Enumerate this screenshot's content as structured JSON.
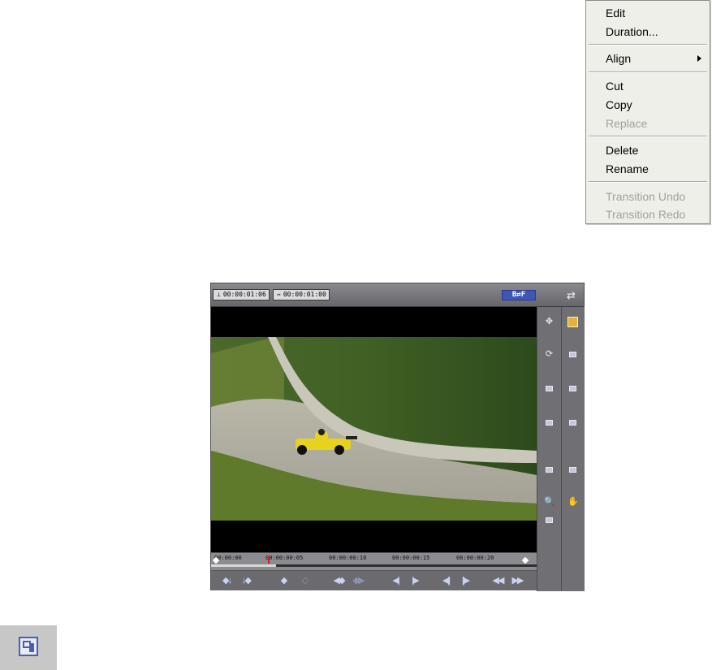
{
  "context_menu": {
    "items": [
      {
        "label": "Edit",
        "enabled": true
      },
      {
        "label": "Duration...",
        "enabled": true
      },
      {
        "label": "Align",
        "enabled": true,
        "submenu": true
      },
      {
        "label": "Cut",
        "enabled": true
      },
      {
        "label": "Copy",
        "enabled": true
      },
      {
        "label": "Replace",
        "enabled": false
      },
      {
        "label": "Delete",
        "enabled": true
      },
      {
        "label": "Rename",
        "enabled": true
      },
      {
        "label": "Transition Undo",
        "enabled": false
      },
      {
        "label": "Transition Redo",
        "enabled": false
      }
    ]
  },
  "preview": {
    "timecode_position": "00:00:01:06",
    "timecode_duration": "00:00:01:00",
    "bf_toggle": "B⇄F",
    "ruler_ticks": [
      "00:00:00",
      "00:00:00:05",
      "00:00:00:10",
      "00:00:00:15",
      "00:00:00:20"
    ],
    "colors": {
      "accent": "#3f56b8",
      "playhead": "#cc2222",
      "panel": "#6e6e72"
    }
  },
  "icons": {
    "save_icon": "save-template-icon"
  }
}
